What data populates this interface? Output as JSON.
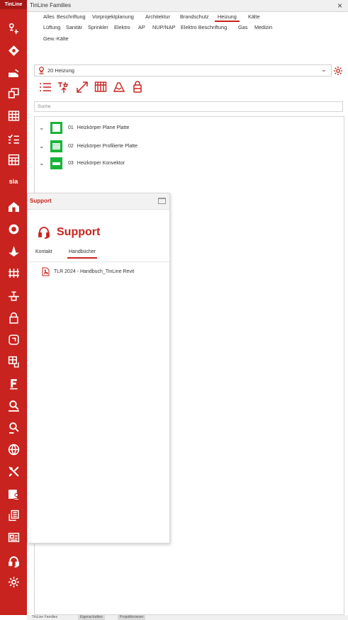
{
  "app": {
    "logo": "TinLine",
    "title": "TinLine Families",
    "close": "×"
  },
  "rail": {
    "icons": [
      "key-connector-icon",
      "diamond-icon",
      "truck-icon",
      "window-icon",
      "grid-building-icon",
      "checklist-icon",
      "layout-grid-icon",
      "sia-icon",
      "house-icon",
      "badge-icon",
      "triangle-figure-icon",
      "fence-icon",
      "pipe-junction-icon",
      "lock-icon",
      "device-icon",
      "cabinet-icon",
      "f-label-icon",
      "search-tabs-icon",
      "search-kh-icon",
      "globe-icon",
      "tools-icon",
      "folder-user-icon",
      "document-stack-icon",
      "id-card-icon",
      "headset-icon",
      "gear-icon"
    ],
    "sia_label": "sia"
  },
  "categories": [
    {
      "label": "Alles",
      "active": false
    },
    {
      "label": "Beschriftung",
      "active": false
    },
    {
      "label": "Vorprojektplanung",
      "active": false
    },
    {
      "label": "Architektur",
      "active": false
    },
    {
      "label": "Brandschutz",
      "active": false
    },
    {
      "label": "Heizung",
      "active": true
    },
    {
      "label": "Kälte",
      "active": false
    },
    {
      "label": "Lüftung",
      "active": false
    },
    {
      "label": "Sanitär",
      "active": false
    },
    {
      "label": "Sprinkler",
      "active": false
    },
    {
      "label": "Elektro",
      "active": false
    },
    {
      "label": "AP",
      "active": false
    },
    {
      "label": "NUP/NAP",
      "active": false
    },
    {
      "label": "Elektro Beschriftung",
      "active": false
    },
    {
      "label": "Gas",
      "active": false
    },
    {
      "label": "Medizin",
      "active": false
    },
    {
      "label": "Gew.-Kälte",
      "active": false
    }
  ],
  "dropdown": {
    "value": "20 Heizung",
    "icon": "heating-flame-icon"
  },
  "toolbar": {
    "buttons": [
      "list-icon",
      "arrow-up-insert-icon",
      "diagonal-arrows-icon",
      "radiator-icon",
      "heater-outline-icon",
      "valve-icon"
    ]
  },
  "search": {
    "placeholder": "Suche"
  },
  "families": [
    {
      "code": "01",
      "name": "Heizkörper Plane Platte"
    },
    {
      "code": "02",
      "name": "Heizkörper Profilierte Platte"
    },
    {
      "code": "03",
      "name": "Heizkörper Konvektor"
    }
  ],
  "support": {
    "title": "Support",
    "heading": "Support",
    "tabs": [
      {
        "label": "Kontakt",
        "active": false
      },
      {
        "label": "Handbücher",
        "active": true
      }
    ],
    "document": "TLR 2024 - Handbuch_TinLine Revit"
  },
  "stray_text": "g",
  "bottom_tabs": [
    "TinLine Families",
    "Eigenschaften",
    "Projektbrowser"
  ],
  "colors": {
    "accent": "#c8231e",
    "thumb": "#19b43a"
  }
}
